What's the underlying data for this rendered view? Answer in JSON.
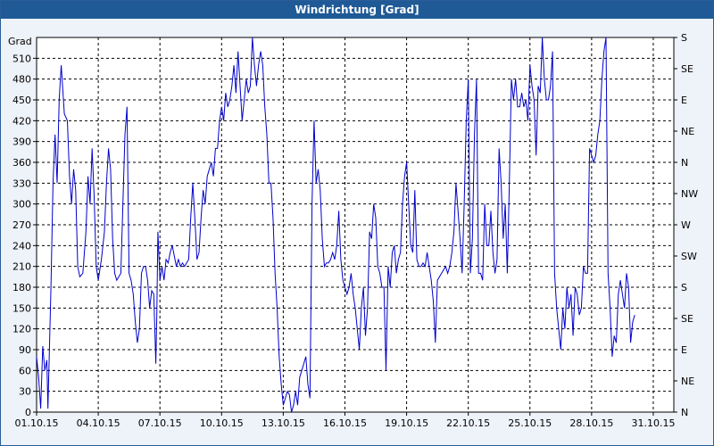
{
  "window": {
    "title": "Windrichtung [Grad]"
  },
  "chart_data": {
    "type": "line",
    "title": "Windrichtung [Grad]",
    "ylabel": "Grad",
    "ylim": [
      0,
      540
    ],
    "y_ticks": [
      0,
      30,
      60,
      90,
      120,
      150,
      180,
      210,
      240,
      270,
      300,
      330,
      360,
      390,
      420,
      450,
      480,
      510
    ],
    "y2_ticks": [
      {
        "value": 0,
        "label": "N"
      },
      {
        "value": 45,
        "label": "NE"
      },
      {
        "value": 90,
        "label": "E"
      },
      {
        "value": 135,
        "label": "SE"
      },
      {
        "value": 180,
        "label": "S"
      },
      {
        "value": 225,
        "label": "SW"
      },
      {
        "value": 270,
        "label": "W"
      },
      {
        "value": 315,
        "label": "NW"
      },
      {
        "value": 360,
        "label": "N"
      },
      {
        "value": 405,
        "label": "NE"
      },
      {
        "value": 450,
        "label": "E"
      },
      {
        "value": 495,
        "label": "SE"
      },
      {
        "value": 540,
        "label": "S"
      }
    ],
    "xlim": [
      0,
      31
    ],
    "x_ticks": [
      {
        "day": 0,
        "label": "01.10.15"
      },
      {
        "day": 3,
        "label": "04.10.15"
      },
      {
        "day": 6,
        "label": "07.10.15"
      },
      {
        "day": 9,
        "label": "10.10.15"
      },
      {
        "day": 12,
        "label": "13.10.15"
      },
      {
        "day": 15,
        "label": "16.10.15"
      },
      {
        "day": 18,
        "label": "19.10.15"
      },
      {
        "day": 21,
        "label": "22.10.15"
      },
      {
        "day": 24,
        "label": "25.10.15"
      },
      {
        "day": 27,
        "label": "28.10.15"
      },
      {
        "day": 30,
        "label": "31.10.15"
      }
    ],
    "grid": true,
    "line_color": "#0000cc",
    "series": [
      {
        "name": "",
        "points": [
          [
            0.0,
            80
          ],
          [
            0.1,
            50
          ],
          [
            0.2,
            5
          ],
          [
            0.3,
            95
          ],
          [
            0.4,
            60
          ],
          [
            0.5,
            75
          ],
          [
            0.55,
            5
          ],
          [
            0.7,
            180
          ],
          [
            0.8,
            330
          ],
          [
            0.9,
            400
          ],
          [
            1.0,
            330
          ],
          [
            1.1,
            450
          ],
          [
            1.2,
            500
          ],
          [
            1.35,
            430
          ],
          [
            1.5,
            420
          ],
          [
            1.6,
            340
          ],
          [
            1.7,
            300
          ],
          [
            1.8,
            350
          ],
          [
            1.9,
            320
          ],
          [
            2.0,
            210
          ],
          [
            2.1,
            195
          ],
          [
            2.25,
            200
          ],
          [
            2.4,
            260
          ],
          [
            2.5,
            340
          ],
          [
            2.6,
            300
          ],
          [
            2.7,
            380
          ],
          [
            2.8,
            310
          ],
          [
            2.9,
            210
          ],
          [
            3.0,
            190
          ],
          [
            3.15,
            220
          ],
          [
            3.3,
            260
          ],
          [
            3.4,
            330
          ],
          [
            3.5,
            380
          ],
          [
            3.6,
            350
          ],
          [
            3.7,
            250
          ],
          [
            3.8,
            200
          ],
          [
            3.9,
            190
          ],
          [
            4.0,
            195
          ],
          [
            4.1,
            200
          ],
          [
            4.2,
            300
          ],
          [
            4.3,
            400
          ],
          [
            4.4,
            440
          ],
          [
            4.5,
            200
          ],
          [
            4.6,
            190
          ],
          [
            4.7,
            170
          ],
          [
            4.8,
            130
          ],
          [
            4.9,
            100
          ],
          [
            5.0,
            120
          ],
          [
            5.1,
            200
          ],
          [
            5.2,
            210
          ],
          [
            5.3,
            210
          ],
          [
            5.4,
            190
          ],
          [
            5.5,
            150
          ],
          [
            5.6,
            175
          ],
          [
            5.7,
            170
          ],
          [
            5.8,
            70
          ],
          [
            5.85,
            140
          ],
          [
            5.9,
            260
          ],
          [
            6.0,
            190
          ],
          [
            6.1,
            210
          ],
          [
            6.2,
            190
          ],
          [
            6.3,
            220
          ],
          [
            6.4,
            215
          ],
          [
            6.5,
            230
          ],
          [
            6.6,
            240
          ],
          [
            6.7,
            225
          ],
          [
            6.8,
            210
          ],
          [
            6.9,
            220
          ],
          [
            7.0,
            210
          ],
          [
            7.1,
            215
          ],
          [
            7.2,
            210
          ],
          [
            7.4,
            220
          ],
          [
            7.5,
            280
          ],
          [
            7.6,
            330
          ],
          [
            7.7,
            280
          ],
          [
            7.8,
            220
          ],
          [
            7.9,
            230
          ],
          [
            8.0,
            280
          ],
          [
            8.1,
            320
          ],
          [
            8.2,
            300
          ],
          [
            8.3,
            340
          ],
          [
            8.4,
            350
          ],
          [
            8.5,
            360
          ],
          [
            8.6,
            340
          ],
          [
            8.7,
            380
          ],
          [
            8.8,
            380
          ],
          [
            8.9,
            420
          ],
          [
            9.0,
            440
          ],
          [
            9.1,
            420
          ],
          [
            9.2,
            460
          ],
          [
            9.3,
            440
          ],
          [
            9.4,
            450
          ],
          [
            9.5,
            470
          ],
          [
            9.6,
            500
          ],
          [
            9.7,
            460
          ],
          [
            9.8,
            520
          ],
          [
            9.9,
            470
          ],
          [
            10.0,
            420
          ],
          [
            10.1,
            450
          ],
          [
            10.2,
            480
          ],
          [
            10.3,
            460
          ],
          [
            10.4,
            470
          ],
          [
            10.5,
            540
          ],
          [
            10.6,
            500
          ],
          [
            10.7,
            470
          ],
          [
            10.8,
            500
          ],
          [
            10.9,
            520
          ],
          [
            11.0,
            500
          ],
          [
            11.1,
            440
          ],
          [
            11.2,
            400
          ],
          [
            11.3,
            330
          ],
          [
            11.4,
            330
          ],
          [
            11.5,
            280
          ],
          [
            11.6,
            200
          ],
          [
            11.7,
            150
          ],
          [
            11.8,
            80
          ],
          [
            11.9,
            40
          ],
          [
            12.0,
            10
          ],
          [
            12.1,
            20
          ],
          [
            12.2,
            30
          ],
          [
            12.3,
            25
          ],
          [
            12.4,
            0
          ],
          [
            12.5,
            10
          ],
          [
            12.6,
            30
          ],
          [
            12.7,
            10
          ],
          [
            12.8,
            50
          ],
          [
            12.9,
            60
          ],
          [
            13.0,
            70
          ],
          [
            13.1,
            80
          ],
          [
            13.2,
            40
          ],
          [
            13.3,
            20
          ],
          [
            13.4,
            300
          ],
          [
            13.5,
            420
          ],
          [
            13.6,
            330
          ],
          [
            13.7,
            350
          ],
          [
            13.8,
            320
          ],
          [
            13.9,
            250
          ],
          [
            14.0,
            210
          ],
          [
            14.1,
            215
          ],
          [
            14.2,
            215
          ],
          [
            14.3,
            220
          ],
          [
            14.4,
            230
          ],
          [
            14.5,
            220
          ],
          [
            14.6,
            240
          ],
          [
            14.7,
            290
          ],
          [
            14.8,
            220
          ],
          [
            14.9,
            190
          ],
          [
            15.0,
            180
          ],
          [
            15.1,
            170
          ],
          [
            15.2,
            180
          ],
          [
            15.3,
            200
          ],
          [
            15.4,
            170
          ],
          [
            15.5,
            150
          ],
          [
            15.6,
            120
          ],
          [
            15.7,
            90
          ],
          [
            15.8,
            150
          ],
          [
            15.9,
            180
          ],
          [
            16.0,
            110
          ],
          [
            16.1,
            150
          ],
          [
            16.2,
            260
          ],
          [
            16.3,
            250
          ],
          [
            16.4,
            300
          ],
          [
            16.5,
            280
          ],
          [
            16.6,
            210
          ],
          [
            16.7,
            200
          ],
          [
            16.8,
            180
          ],
          [
            16.9,
            180
          ],
          [
            17.0,
            60
          ],
          [
            17.1,
            210
          ],
          [
            17.2,
            180
          ],
          [
            17.3,
            230
          ],
          [
            17.4,
            240
          ],
          [
            17.5,
            200
          ],
          [
            17.6,
            220
          ],
          [
            17.7,
            230
          ],
          [
            17.8,
            300
          ],
          [
            17.9,
            340
          ],
          [
            18.0,
            360
          ],
          [
            18.1,
            300
          ],
          [
            18.2,
            240
          ],
          [
            18.3,
            230
          ],
          [
            18.4,
            320
          ],
          [
            18.5,
            220
          ],
          [
            18.6,
            210
          ],
          [
            18.7,
            210
          ],
          [
            18.8,
            215
          ],
          [
            18.9,
            210
          ],
          [
            19.0,
            230
          ],
          [
            19.1,
            210
          ],
          [
            19.2,
            190
          ],
          [
            19.3,
            160
          ],
          [
            19.4,
            100
          ],
          [
            19.5,
            190
          ],
          [
            19.7,
            200
          ],
          [
            19.9,
            210
          ],
          [
            20.0,
            200
          ],
          [
            20.1,
            210
          ],
          [
            20.2,
            230
          ],
          [
            20.3,
            260
          ],
          [
            20.4,
            330
          ],
          [
            20.5,
            290
          ],
          [
            20.6,
            250
          ],
          [
            20.7,
            200
          ],
          [
            20.8,
            300
          ],
          [
            20.9,
            420
          ],
          [
            21.0,
            480
          ],
          [
            21.1,
            200
          ],
          [
            21.2,
            250
          ],
          [
            21.3,
            400
          ],
          [
            21.4,
            480
          ],
          [
            21.5,
            200
          ],
          [
            21.6,
            200
          ],
          [
            21.7,
            190
          ],
          [
            21.8,
            300
          ],
          [
            21.9,
            240
          ],
          [
            22.0,
            240
          ],
          [
            22.1,
            290
          ],
          [
            22.2,
            230
          ],
          [
            22.3,
            200
          ],
          [
            22.4,
            220
          ],
          [
            22.5,
            380
          ],
          [
            22.6,
            330
          ],
          [
            22.7,
            250
          ],
          [
            22.8,
            300
          ],
          [
            22.9,
            200
          ],
          [
            23.0,
            330
          ],
          [
            23.1,
            480
          ],
          [
            23.2,
            450
          ],
          [
            23.3,
            480
          ],
          [
            23.4,
            440
          ],
          [
            23.5,
            440
          ],
          [
            23.6,
            460
          ],
          [
            23.7,
            440
          ],
          [
            23.8,
            450
          ],
          [
            23.9,
            420
          ],
          [
            24.0,
            500
          ],
          [
            24.1,
            470
          ],
          [
            24.2,
            450
          ],
          [
            24.3,
            370
          ],
          [
            24.4,
            470
          ],
          [
            24.5,
            460
          ],
          [
            24.6,
            540
          ],
          [
            24.7,
            480
          ],
          [
            24.8,
            450
          ],
          [
            24.9,
            450
          ],
          [
            25.0,
            470
          ],
          [
            25.1,
            520
          ],
          [
            25.2,
            200
          ],
          [
            25.3,
            150
          ],
          [
            25.4,
            120
          ],
          [
            25.5,
            90
          ],
          [
            25.6,
            150
          ],
          [
            25.7,
            120
          ],
          [
            25.8,
            180
          ],
          [
            25.9,
            150
          ],
          [
            26.0,
            170
          ],
          [
            26.1,
            110
          ],
          [
            26.2,
            180
          ],
          [
            26.3,
            170
          ],
          [
            26.4,
            140
          ],
          [
            26.5,
            150
          ],
          [
            26.6,
            210
          ],
          [
            26.7,
            200
          ],
          [
            26.8,
            200
          ],
          [
            26.9,
            380
          ],
          [
            27.0,
            370
          ],
          [
            27.1,
            360
          ],
          [
            27.2,
            370
          ],
          [
            27.3,
            400
          ],
          [
            27.4,
            420
          ],
          [
            27.5,
            480
          ],
          [
            27.6,
            520
          ],
          [
            27.7,
            540
          ],
          [
            27.8,
            200
          ],
          [
            27.9,
            150
          ],
          [
            28.0,
            80
          ],
          [
            28.1,
            110
          ],
          [
            28.2,
            100
          ],
          [
            28.3,
            170
          ],
          [
            28.4,
            190
          ],
          [
            28.5,
            170
          ],
          [
            28.6,
            150
          ],
          [
            28.7,
            200
          ],
          [
            28.8,
            180
          ],
          [
            28.9,
            100
          ],
          [
            29.0,
            130
          ],
          [
            29.1,
            140
          ]
        ]
      }
    ]
  }
}
